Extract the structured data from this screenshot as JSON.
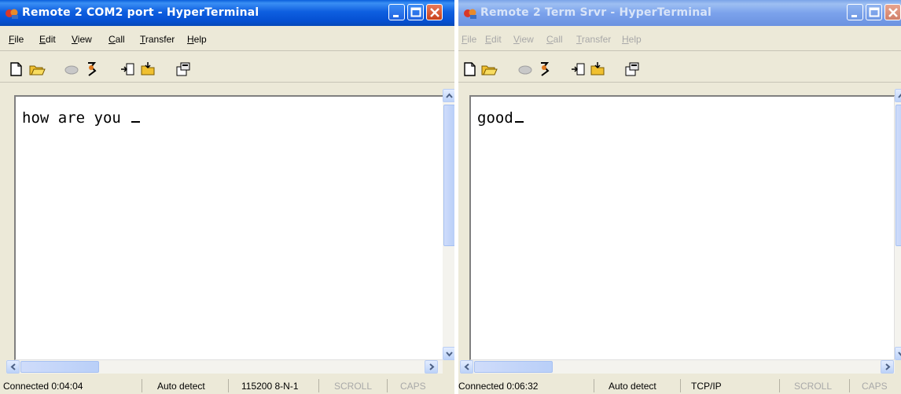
{
  "window_left": {
    "title": "Remote 2 COM2 port - HyperTerminal",
    "menu": [
      "File",
      "Edit",
      "View",
      "Call",
      "Transfer",
      "Help"
    ],
    "terminal_text": "how are you ",
    "status": {
      "connection": "Connected 0:04:04",
      "detect": "Auto detect",
      "port_settings": "115200 8-N-1",
      "scroll": "SCROLL",
      "caps": "CAPS"
    }
  },
  "window_right": {
    "title": "Remote 2 Term Srvr - HyperTerminal",
    "menu": [
      "File",
      "Edit",
      "View",
      "Call",
      "Transfer",
      "Help"
    ],
    "terminal_text": "good",
    "status": {
      "connection": "Connected 0:06:32",
      "detect": "Auto detect",
      "port_settings": "TCP/IP",
      "scroll": "SCROLL",
      "caps": "CAPS"
    }
  },
  "icons": [
    "hyperterminal-app-icon",
    "new-icon",
    "open-icon",
    "disconnect-icon",
    "dial-icon",
    "send-icon",
    "receive-icon",
    "properties-icon"
  ],
  "colors": {
    "titlebar_active": "#0a5fdc",
    "titlebar_inactive": "#7ba3e8",
    "close_button": "#c8401a",
    "frame": "#ece9d8"
  }
}
